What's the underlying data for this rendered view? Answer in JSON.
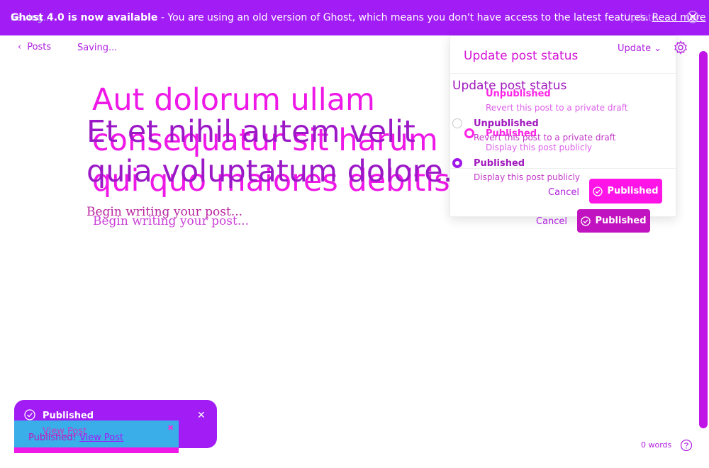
{
  "banner": {
    "ghost_text": "Saving...",
    "ghost_update": "Update",
    "product": "Ghost 4.0 is now available",
    "message": " - You are using an old version of Ghost, which means you don't have access to the latest features. ",
    "link": "Read more"
  },
  "toolbar": {
    "back_label": "Posts",
    "status": "Saving..."
  },
  "editor": {
    "title_ghost": "Aut dolorum ullam consequatur sit harum qui quo maiores debitis.",
    "title": "Et et nihil autem velit quia voluptatum dolore.",
    "placeholder": "Begin writing your post...",
    "placeholder_ghost": "Begin writing your post..."
  },
  "panel": {
    "title": "Update post status",
    "update_label": "Update",
    "title_echo": "Update post status",
    "ghost_options": [
      {
        "label": "Unpublished",
        "desc": "Revert this post to a private draft"
      },
      {
        "label": "Published",
        "desc": "Display this post publicly"
      }
    ],
    "options": [
      {
        "label": "Unpublished",
        "desc": "Revert this post to a private draft",
        "selected": false
      },
      {
        "label": "Published",
        "desc": "Display this post publicly",
        "selected": true
      }
    ],
    "cancel_label": "Cancel",
    "published_label": "Published"
  },
  "footer_actions": {
    "cancel_label": "Cancel",
    "published_label": "Published"
  },
  "toast": {
    "title": "Published",
    "ghost_link": "View Post",
    "body_prefix": "Published!",
    "link": "View Post"
  },
  "status_bar": {
    "word_count": "0 words"
  },
  "colors": {
    "accent": "#a21cf5",
    "magenta": "#ee18e7",
    "button": "#c114c0"
  }
}
